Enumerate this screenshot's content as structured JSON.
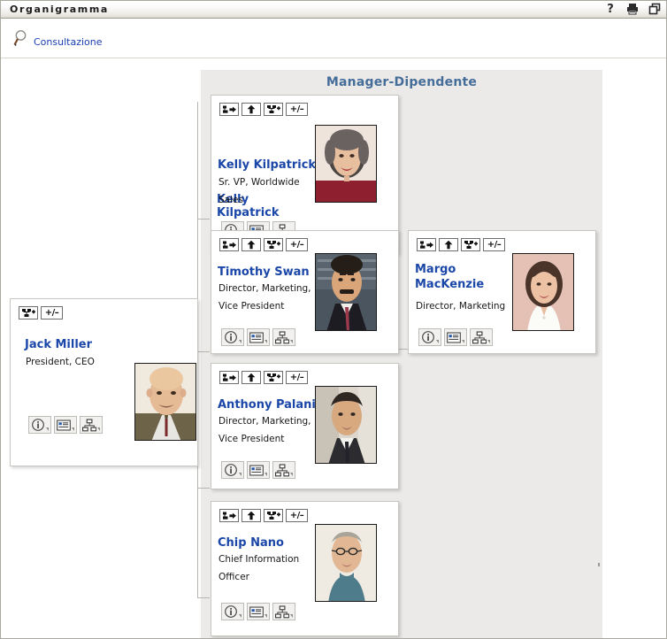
{
  "window": {
    "title": "Organigramma",
    "icons": [
      {
        "name": "help-icon",
        "glyph": "?"
      },
      {
        "name": "print-icon",
        "glyph": "printer"
      },
      {
        "name": "restore-window-icon",
        "glyph": "windows"
      }
    ]
  },
  "toolbar": {
    "search_icon": "magnifier-icon",
    "search_label": "Consultazione"
  },
  "chart": {
    "panel_title": "Manager-Dipendente",
    "accent_color": "#456d9a",
    "name_color": "#1a47a8",
    "panel_bg": "#eceae8",
    "card_toolbar_buttons": [
      {
        "name": "go-to-manager-button",
        "icon": "org-left-arrow-icon",
        "label": ""
      },
      {
        "name": "move-up-button",
        "icon": "up-arrow-icon",
        "label": ""
      },
      {
        "name": "add-relation-button",
        "icon": "org-plus-icon",
        "label": ""
      },
      {
        "name": "expand-collapse-button",
        "icon": "plus-minus-icon",
        "label": "+/–"
      }
    ],
    "card_action_buttons": [
      {
        "name": "details-menu-button",
        "icon": "info-circle-icon"
      },
      {
        "name": "vcard-menu-button",
        "icon": "id-card-icon"
      },
      {
        "name": "org-chart-menu-button",
        "icon": "org-chart-icon"
      }
    ],
    "root": {
      "name": "Jack Miller",
      "title_line1": "President, CEO",
      "title_line2": "",
      "photo": "jack-miller-photo",
      "toolbar": [
        "add-relation-button",
        "expand-collapse-button"
      ]
    },
    "subordinates": [
      {
        "name": "Kelly Kilpatrick",
        "title_line1": "Sr. VP, Worldwide",
        "title_line2": "Sales",
        "photo": "kelly-kilpatrick-photo"
      },
      {
        "name": "Timothy Swan",
        "title_line1": "Director, Marketing,",
        "title_line2": "Vice President",
        "photo": "timothy-swan-photo"
      },
      {
        "name": "Anthony Palani",
        "title_line1": "Director, Marketing,",
        "title_line2": "Vice President",
        "photo": "anthony-palani-photo"
      },
      {
        "name": "Chip Nano",
        "title_line1": "Chief Information",
        "title_line2": "Officer",
        "photo": "chip-nano-photo"
      }
    ],
    "second_level": [
      {
        "name_line1": "Margo",
        "name_line2": "MacKenzie",
        "title_line1": "Director, Marketing",
        "title_line2": "",
        "photo": "margo-mackenzie-photo"
      }
    ]
  }
}
